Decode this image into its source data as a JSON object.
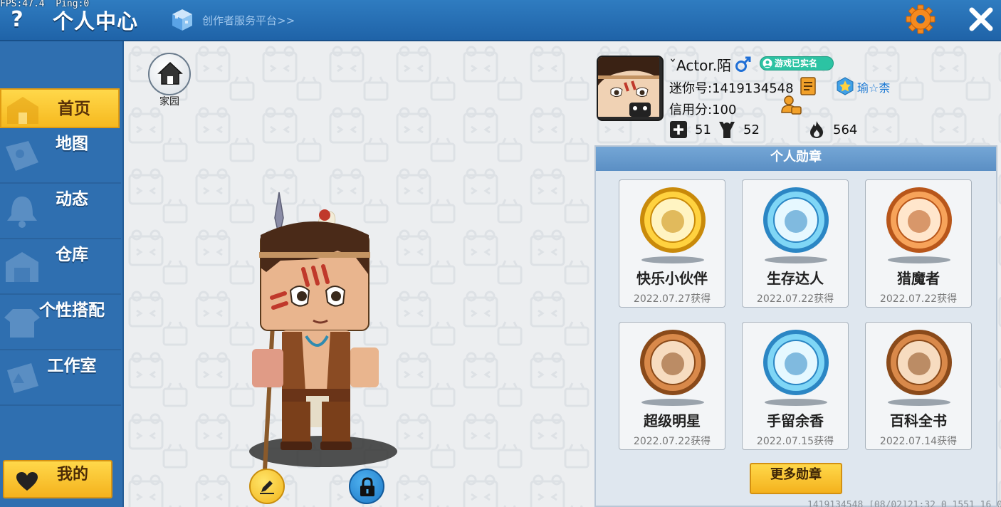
{
  "debug": {
    "text": "FPS:47.4  Ping:0"
  },
  "topbar": {
    "help": "?",
    "title": "个人中心",
    "creator_link": "创作者服务平台>>",
    "icons": {
      "help": "question-icon",
      "creator": "cube-icon",
      "settings": "gear-icon",
      "close": "close-icon"
    }
  },
  "sidebar": {
    "items": [
      {
        "label": "首页",
        "icon": "home-banner-icon",
        "active": true
      },
      {
        "label": "地图",
        "icon": "map-icon",
        "active": false
      },
      {
        "label": "动态",
        "icon": "bell-icon",
        "active": false
      },
      {
        "label": "仓库",
        "icon": "warehouse-icon",
        "active": false
      },
      {
        "label": "个性搭配",
        "icon": "wardrobe-icon",
        "active": false
      },
      {
        "label": "工作室",
        "icon": "studio-icon",
        "active": false
      }
    ],
    "mine_button": "我的"
  },
  "main": {
    "home_label": "家园"
  },
  "profile": {
    "name": "ˇActor.陌",
    "gender": "male",
    "verified": "游戏已实名",
    "mini_id": "迷你号:1419134548",
    "clan": "瑜☆柰",
    "credit": "信用分:100",
    "stats": {
      "friends": "51",
      "fans": "52",
      "popularity": "564"
    }
  },
  "medals": {
    "title": "个人勋章",
    "items": [
      {
        "name": "快乐小伙伴",
        "date": "2022.07.27获得",
        "ring": "gold"
      },
      {
        "name": "生存达人",
        "date": "2022.07.22获得",
        "ring": "blue"
      },
      {
        "name": "猎魔者",
        "date": "2022.07.22获得",
        "ring": "orange"
      },
      {
        "name": "超级明星",
        "date": "2022.07.22获得",
        "ring": "bronze"
      },
      {
        "name": "手留余香",
        "date": "2022.07.15获得",
        "ring": "blue"
      },
      {
        "name": "百科全书",
        "date": "2022.07.14获得",
        "ring": "bronze"
      }
    ],
    "more": "更多勋章"
  },
  "footer": {
    "text": "1419134548   [08/02]21:32 0_1551 16 0"
  },
  "colors": {
    "topbar": "#2f7cc0",
    "sidebar": "#2f6fb0",
    "accent_yellow": "#f6b91f",
    "medal_header": "#5b8fc4"
  }
}
